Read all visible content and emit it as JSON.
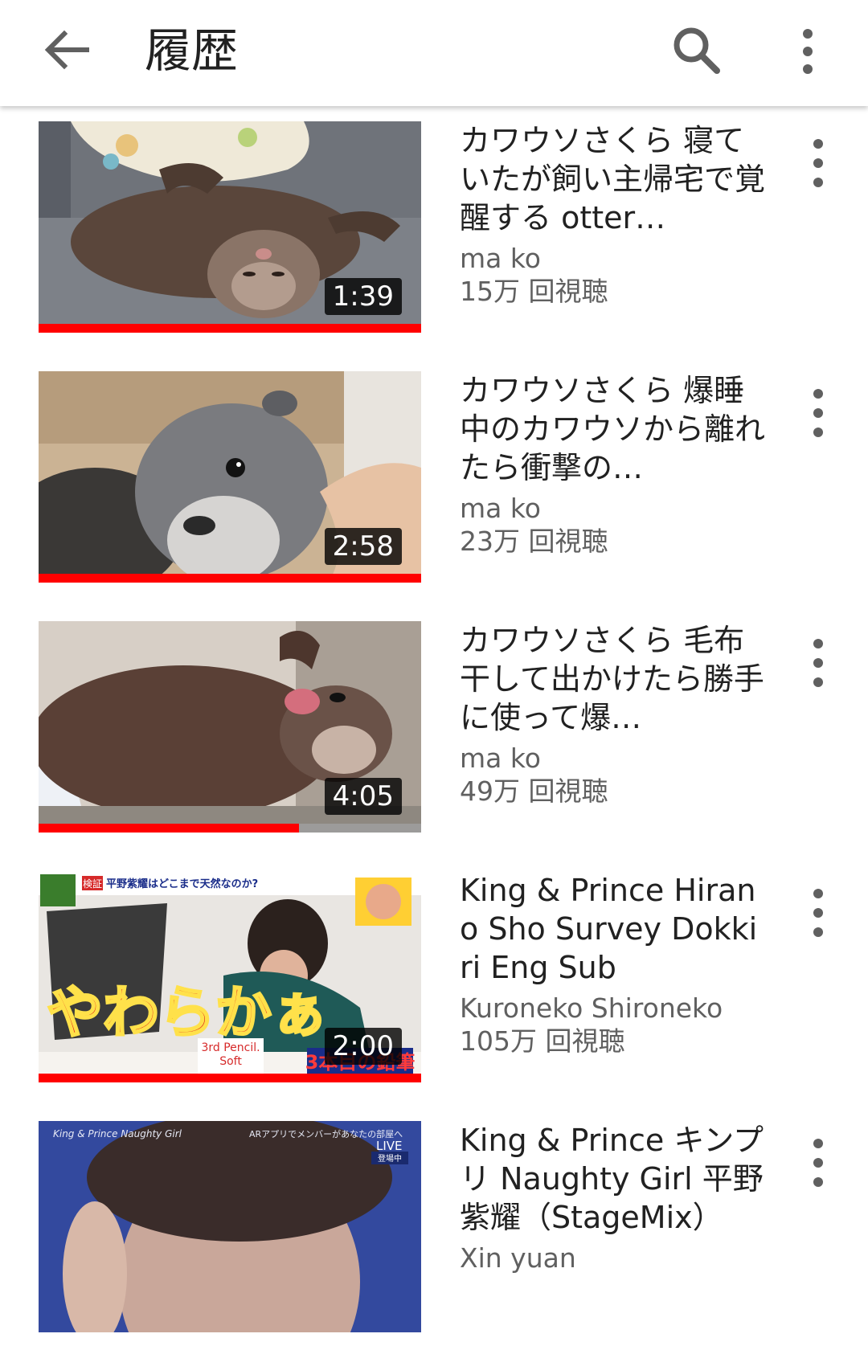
{
  "appbar": {
    "title": "履歴"
  },
  "videos": [
    {
      "title": "カワウソさくら 寝ていたが飼い主帰宅で覚醒する otter…",
      "channel": "ma ko",
      "views": "15万 回視聴",
      "duration": "1:39",
      "watched_fraction": 1.0
    },
    {
      "title": "カワウソさくら 爆睡中のカワウソから離れたら衝撃の…",
      "channel": "ma ko",
      "views": "23万 回視聴",
      "duration": "2:58",
      "watched_fraction": 1.0
    },
    {
      "title": "カワウソさくら 毛布干して出かけたら勝手に使って爆…",
      "channel": "ma ko",
      "views": "49万 回視聴",
      "duration": "4:05",
      "watched_fraction": 0.68
    },
    {
      "title": "King & Prince Hirano Sho Survey Dokkiri Eng Sub",
      "channel": "Kuroneko Shironeko",
      "views": "105万 回視聴",
      "duration": "2:00",
      "watched_fraction": 1.0,
      "thumb_text": {
        "caption": "やわらかぁ",
        "tag": "検証",
        "headline": "平野紫耀はどこまで天然なのか?",
        "pencil_line1": "3rd Pencil.",
        "pencil_line2": "Soft",
        "bottom": "3本目の鉛筆"
      }
    },
    {
      "title": "King & Prince キンプリ Naughty Girl 平野紫耀（StageMix）",
      "channel": "Xin yuan",
      "views": "",
      "duration": "",
      "watched_fraction": 0,
      "thumb_text": {
        "corner": "King & Prince Naughty Girl",
        "ar": "ARアプリでメンバーがあなたの部屋へ",
        "live": "LIVE",
        "now": "登場中"
      }
    }
  ],
  "colors": {
    "progress": "#ff0000",
    "text_primary": "#212121",
    "text_secondary": "#606060"
  },
  "icons": {
    "back": "arrow-back-icon",
    "search": "search-icon",
    "more": "more-vert-icon"
  }
}
